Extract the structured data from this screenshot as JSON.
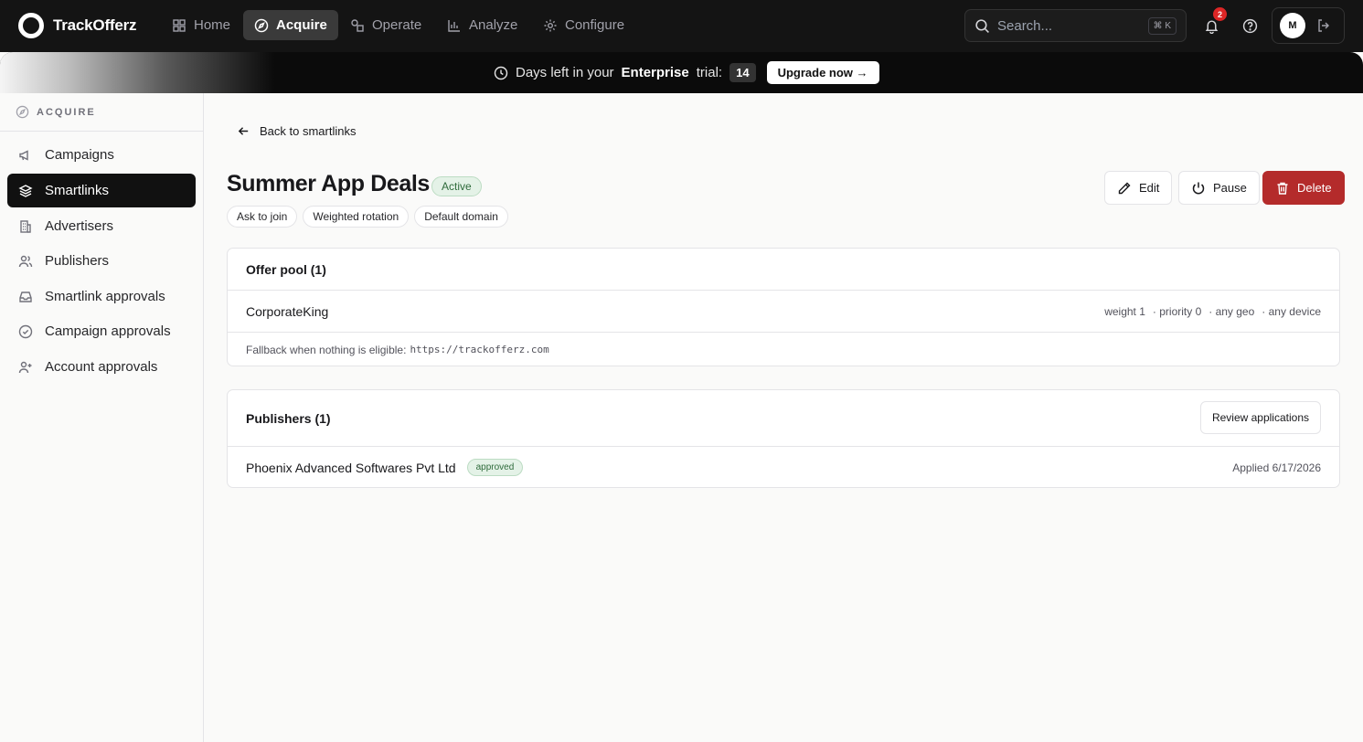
{
  "app": {
    "name": "TrackOfferz"
  },
  "nav": {
    "items": [
      {
        "label": "Home",
        "icon": "grid-icon"
      },
      {
        "label": "Acquire",
        "icon": "compass-icon",
        "active": true
      },
      {
        "label": "Operate",
        "icon": "shapes-icon"
      },
      {
        "label": "Analyze",
        "icon": "bar-chart-icon"
      },
      {
        "label": "Configure",
        "icon": "gear-icon"
      }
    ],
    "search_placeholder": "Search...",
    "search_shortcut": "⌘ K",
    "notifications_count": "2",
    "avatar_initial": "M"
  },
  "banner": {
    "prefix": "Days left in your",
    "plan": "Enterprise",
    "suffix": "trial:",
    "days": "14",
    "upgrade_label": "Upgrade now →"
  },
  "sidebar": {
    "section": "ACQUIRE",
    "items": [
      {
        "label": "Campaigns",
        "icon": "megaphone-icon"
      },
      {
        "label": "Smartlinks",
        "icon": "layers-icon",
        "active": true
      },
      {
        "label": "Advertisers",
        "icon": "building-icon"
      },
      {
        "label": "Publishers",
        "icon": "users-icon"
      },
      {
        "label": "Smartlink approvals",
        "icon": "inbox-icon"
      },
      {
        "label": "Campaign approvals",
        "icon": "check-circle-icon"
      },
      {
        "label": "Account approvals",
        "icon": "user-plus-icon"
      }
    ]
  },
  "page": {
    "back_label": "Back to smartlinks",
    "title": "Summer App Deals",
    "status": "Active",
    "chips": [
      "Ask to join",
      "Weighted rotation",
      "Default domain"
    ],
    "actions": {
      "edit": "Edit",
      "pause": "Pause",
      "delete": "Delete"
    }
  },
  "offer_pool": {
    "heading": "Offer pool (1)",
    "offers": [
      {
        "name": "CorporateKing",
        "weight": "weight 1",
        "priority": "· priority 0",
        "geo": "· any geo",
        "device": "· any device"
      }
    ],
    "fallback_label": "Fallback when nothing is eligible:",
    "fallback_url": "https://trackofferz.com"
  },
  "publishers": {
    "heading": "Publishers (1)",
    "review_label": "Review applications",
    "rows": [
      {
        "name": "Phoenix Advanced Softwares Pvt Ltd",
        "status": "approved",
        "applied": "Applied 6/17/2026"
      }
    ]
  },
  "colors": {
    "accent_dark": "#141414",
    "delete_red": "#b42b2b",
    "success_green": "#2f6b3b"
  }
}
